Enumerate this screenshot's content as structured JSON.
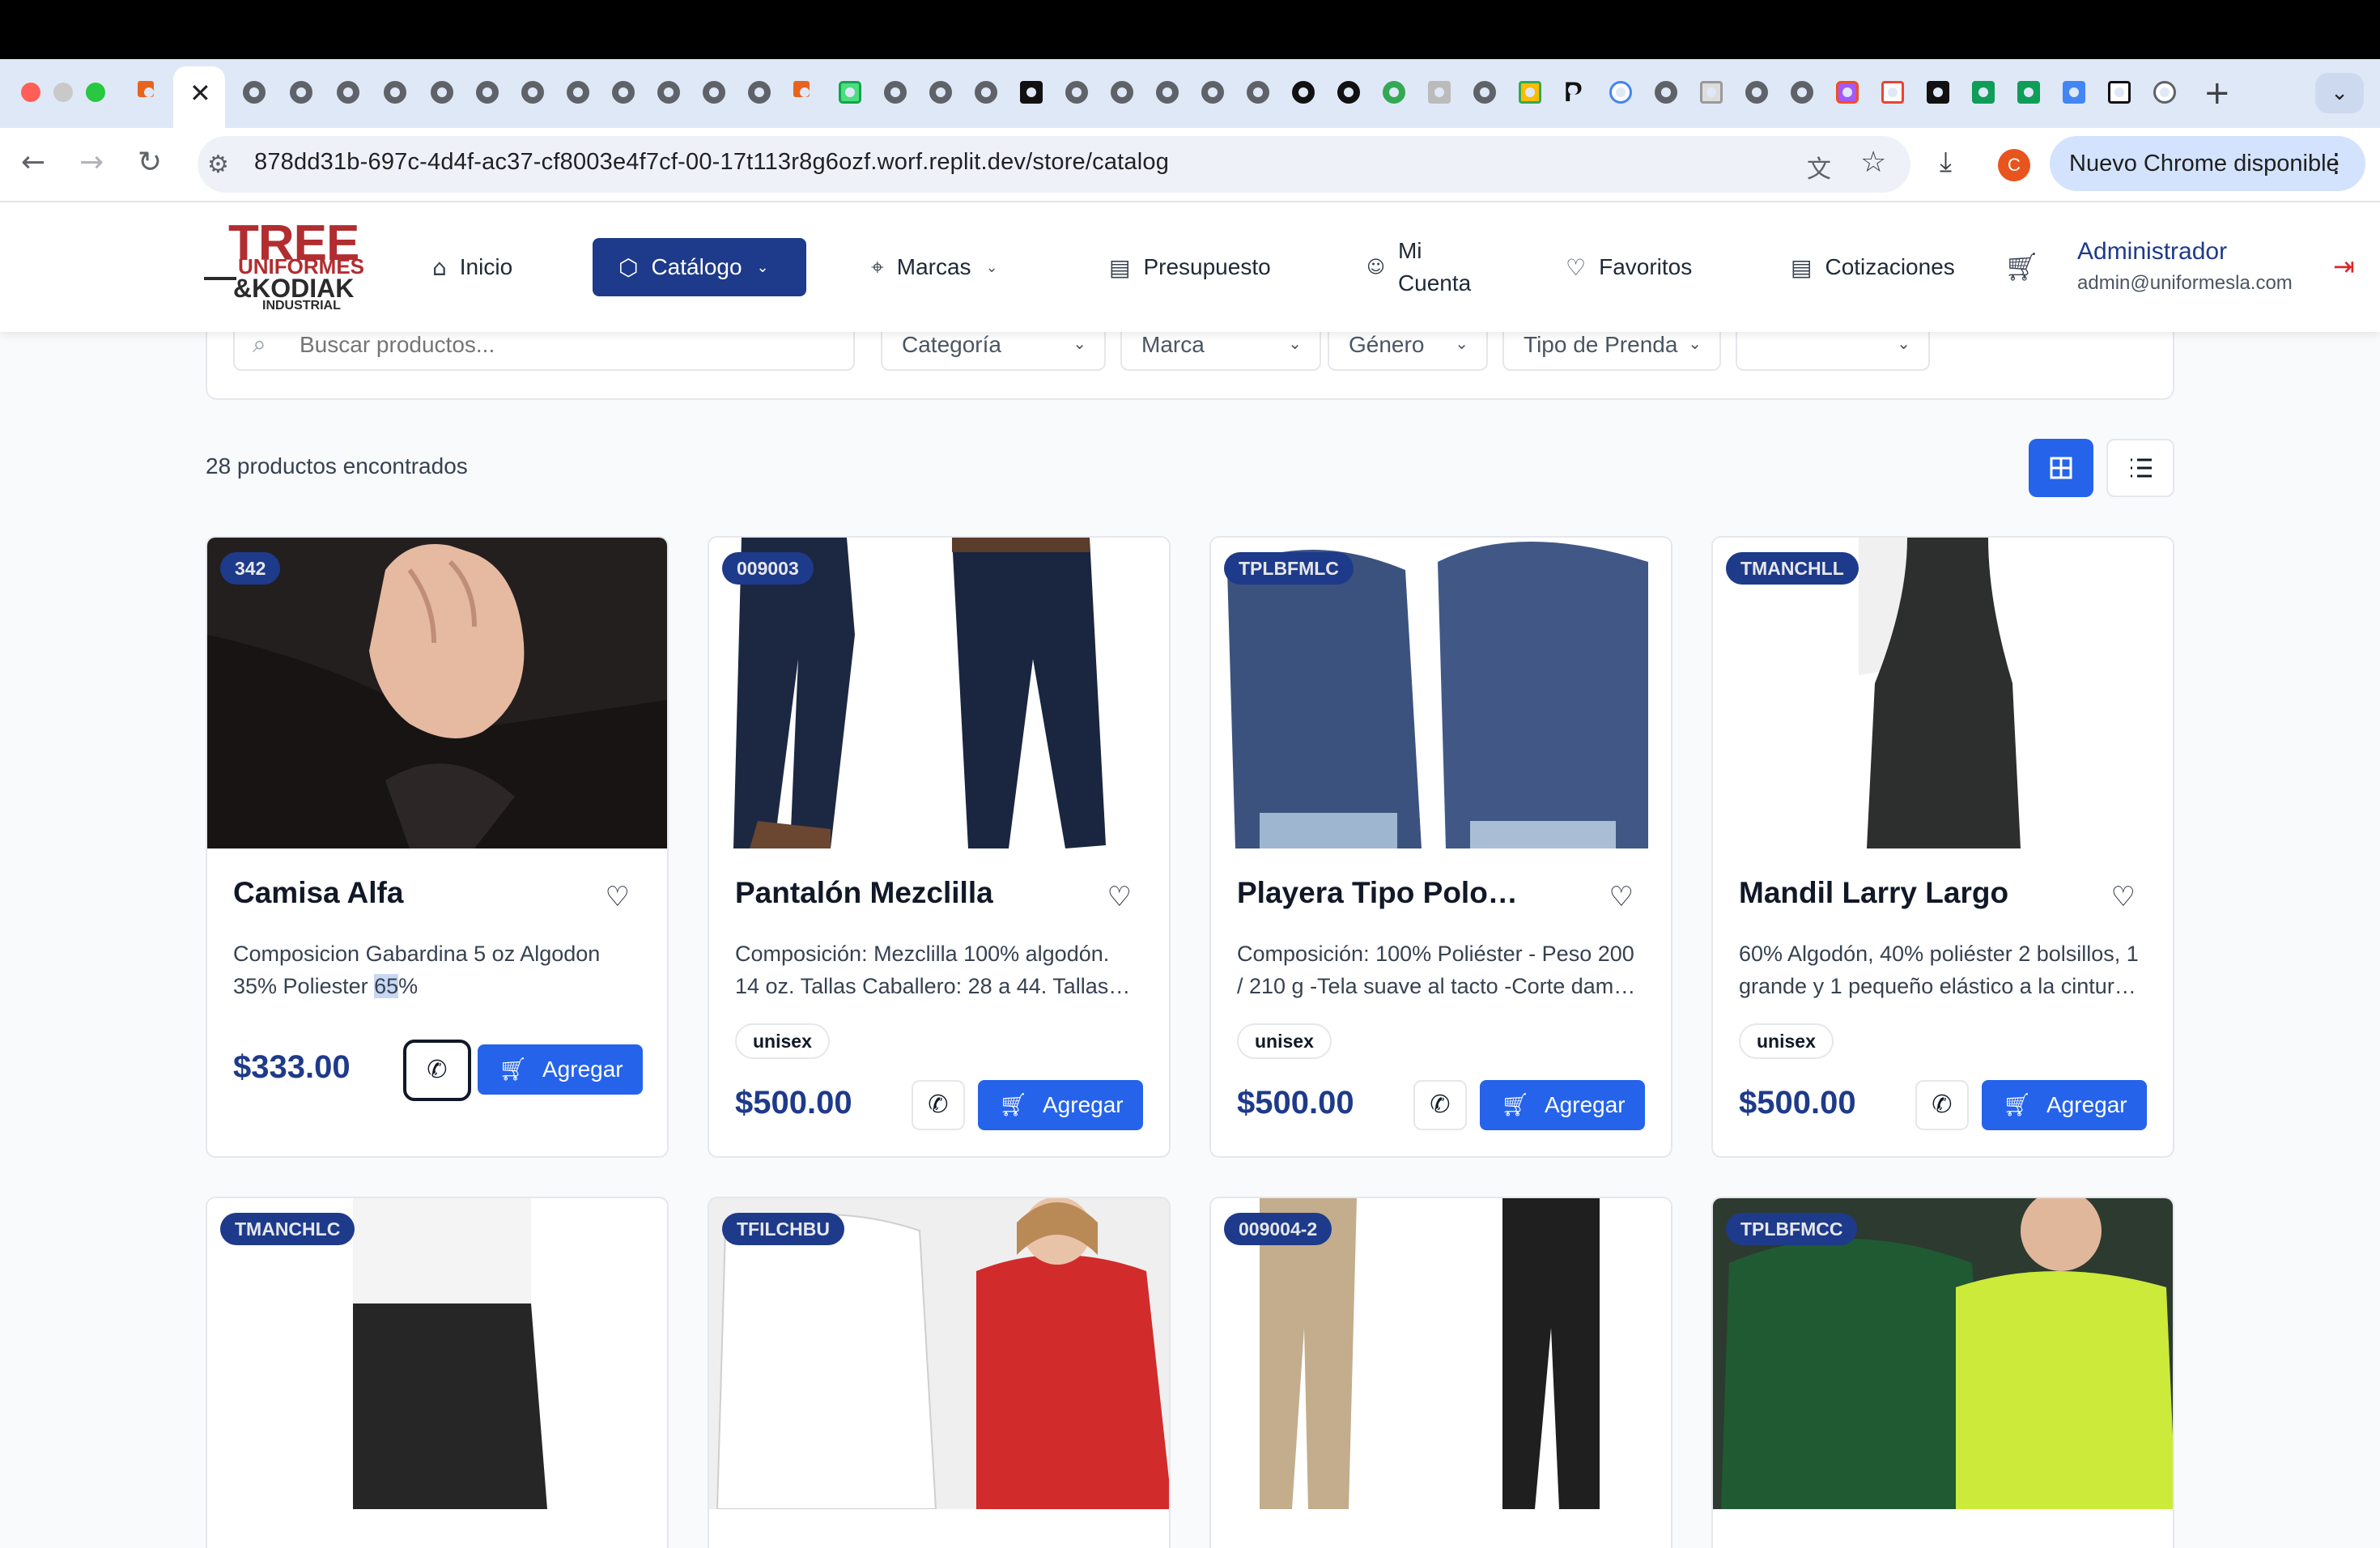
{
  "browser": {
    "url": "878dd31b-697c-4d4f-ac37-cf8003e4f7cf-00-17t113r8g6ozf.worf.replit.dev/store/catalog",
    "update_button": "Nuevo Chrome disponible",
    "profile_initial": "C"
  },
  "header": {
    "logo": {
      "line1": "TREE",
      "line2": "UNIFORMES",
      "line3": "&KODIAK",
      "line4": "INDUSTRIAL"
    },
    "nav": {
      "inicio": "Inicio",
      "catalogo": "Catálogo",
      "marcas": "Marcas",
      "presupuesto": "Presupuesto",
      "mi_cuenta_1": "Mi",
      "mi_cuenta_2": "Cuenta",
      "favoritos": "Favoritos",
      "cotizaciones": "Cotizaciones"
    },
    "user": {
      "name": "Administrador",
      "email": "admin@uniformesla.com"
    }
  },
  "filters": {
    "search_placeholder": "Buscar productos...",
    "categoria": "Categoría",
    "marca": "Marca",
    "genero": "Género",
    "tipo_prenda": "Tipo de Prenda",
    "extra": ""
  },
  "results": {
    "count_text": "28 productos encontrados"
  },
  "products": [
    {
      "code": "342",
      "name": "Camisa Alfa",
      "desc1": "Composicion Gabardina 5 oz Algodon",
      "desc2a": "35% Poliester ",
      "desc2sel": "65",
      "desc2b": "%",
      "tag": "",
      "price": "$333.00",
      "add": "Agregar"
    },
    {
      "code": "009003",
      "name": "Pantalón Mezclilla",
      "desc1": "Composición: Mezclilla 100% algodón.",
      "desc2": "14 oz. Tallas Caballero: 28 a 44. Tallas…",
      "tag": "unisex",
      "price": "$500.00",
      "add": "Agregar"
    },
    {
      "code": "TPLBFMLC",
      "name": "Playera Tipo Polo…",
      "desc1": "Composición: 100% Poliéster - Peso 200",
      "desc2": "/ 210 g -Tela suave al tacto -Corte dam…",
      "tag": "unisex",
      "price": "$500.00",
      "add": "Agregar"
    },
    {
      "code": "TMANCHLL",
      "name": "Mandil Larry Largo",
      "desc1": "60% Algodón, 40% poliéster 2 bolsillos, 1",
      "desc2": "grande y 1 pequeño elástico a la cintur…",
      "tag": "unisex",
      "price": "$500.00",
      "add": "Agregar"
    },
    {
      "code": "TMANCHLC"
    },
    {
      "code": "TFILCHBU"
    },
    {
      "code": "009004-2"
    },
    {
      "code": "TPLBFMCC"
    }
  ],
  "colors": {
    "primary": "#1e3a8a",
    "button": "#2563eb",
    "brand_red": "#b22d30"
  }
}
